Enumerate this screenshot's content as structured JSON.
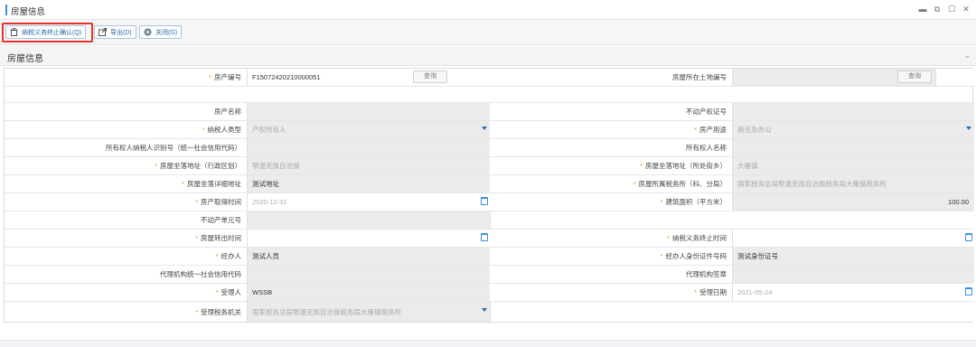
{
  "window": {
    "title": "房屋信息"
  },
  "toolbar": {
    "confirm_label": "纳税义务终止确认(Q)",
    "export_label": "导出(D)",
    "close_label": "关闭(G)"
  },
  "section": {
    "title": "房屋信息"
  },
  "form": {
    "query_label": "查询",
    "house_no_label": "房产编号",
    "house_no_value": "F15072420210000051",
    "land_no_label": "房屋所在土地编号",
    "house_name_label": "房产名称",
    "cert_no_label": "不动产权证号",
    "taxpayer_type_label": "纳税人类型",
    "taxpayer_type_value": "产权所有人",
    "usage_label": "房产用途",
    "usage_value": "商业及办公",
    "owner_id_label": "所有权人纳税人识别号（统一社会信用代码）",
    "owner_name_label": "所有权人名称",
    "district_label": "房屋坐落地址（行政区划）",
    "district_value": "鄂温克族自治旗",
    "street_label": "房屋坐落地址（所处街乡）",
    "street_value": "大雁镇",
    "detail_addr_label": "房屋坐落详细地址",
    "detail_addr_value": "测试地址",
    "tax_office_label": "房屋所属税务所（科、分局）",
    "tax_office_value": "国家税务总局鄂温克族自治旗税务局大雁镇税务所",
    "acquire_time_label": "房产取得时间",
    "acquire_time_value": "2020-12-31",
    "area_label": "建筑面积（平方米）",
    "area_value": "100.00",
    "unit_no_label": "不动产单元号",
    "transfer_time_label": "房屋转出时间",
    "tax_end_label": "纳税义务终止时间",
    "handler_label": "经办人",
    "handler_value": "测试人员",
    "handler_id_label": "经办人身份证件号码",
    "handler_id_value": "测试身份证号",
    "agency_code_label": "代理机构统一社会信用代码",
    "agency_seal_label": "代理机构签章",
    "receiver_label": "受理人",
    "receiver_value": "WSSB",
    "receive_date_label": "受理日期",
    "receive_date_value": "2021-05-24",
    "receive_office_label": "受理税务机关",
    "receive_office_value": "国家税务总局鄂温克族自治旗税务局大雁镇税务所"
  },
  "colors": {
    "accent": "#3a8ee6",
    "required": "#f08c1c",
    "highlight": "#e8312b"
  },
  "icons": [
    "trash-icon",
    "export-icon",
    "close-circle-icon",
    "minimize-icon",
    "restore-icon",
    "maximize-icon",
    "close-icon",
    "chevron-down-icon",
    "calendar-icon",
    "dropdown-arrow-icon"
  ]
}
